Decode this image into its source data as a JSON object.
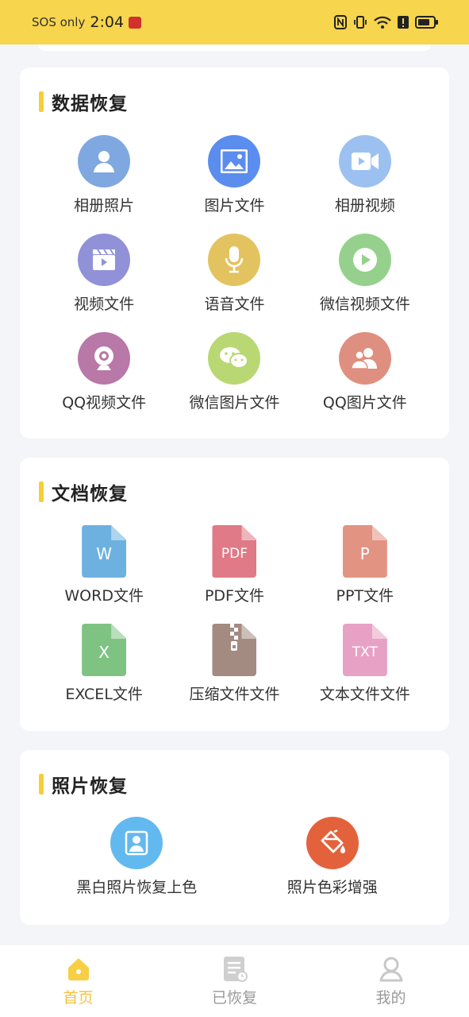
{
  "status": {
    "carrier": "SOS only",
    "time": "2:04"
  },
  "sections": {
    "data_recovery": {
      "title": "数据恢复",
      "items": [
        {
          "label": "相册照片",
          "icon": "user-icon",
          "color": "#7fa8e0"
        },
        {
          "label": "图片文件",
          "icon": "image-icon",
          "color": "#5b8def"
        },
        {
          "label": "相册视频",
          "icon": "video-camera-icon",
          "color": "#9cc1f0"
        },
        {
          "label": "视频文件",
          "icon": "clapper-icon",
          "color": "#9191d8"
        },
        {
          "label": "语音文件",
          "icon": "microphone-icon",
          "color": "#e3c35f"
        },
        {
          "label": "微信视频文件",
          "icon": "play-icon",
          "color": "#95d18c"
        },
        {
          "label": "QQ视频文件",
          "icon": "webcam-icon",
          "color": "#b878a8"
        },
        {
          "label": "微信图片文件",
          "icon": "wechat-icon",
          "color": "#b9d873"
        },
        {
          "label": "QQ图片文件",
          "icon": "group-icon",
          "color": "#df8f80"
        }
      ]
    },
    "doc_recovery": {
      "title": "文档恢复",
      "items": [
        {
          "label": "WORD文件",
          "badge": "W",
          "icon": "word-file-icon",
          "color": "#6db1e0"
        },
        {
          "label": "PDF文件",
          "badge": "PDF",
          "icon": "pdf-file-icon",
          "color": "#e07a86"
        },
        {
          "label": "PPT文件",
          "badge": "P",
          "icon": "ppt-file-icon",
          "color": "#e29382"
        },
        {
          "label": "EXCEL文件",
          "badge": "X",
          "icon": "excel-file-icon",
          "color": "#7fc383"
        },
        {
          "label": "压缩文件文件",
          "badge": "",
          "icon": "zip-file-icon",
          "color": "#a38b82"
        },
        {
          "label": "文本文件文件",
          "badge": "TXT",
          "icon": "txt-file-icon",
          "color": "#e7a1c5"
        }
      ]
    },
    "photo_recovery": {
      "title": "照片恢复",
      "items": [
        {
          "label": "黑白照片恢复上色",
          "icon": "portrait-icon",
          "color": "#62b9ef"
        },
        {
          "label": "照片色彩增强",
          "icon": "paint-bucket-icon",
          "color": "#e3623b"
        }
      ]
    }
  },
  "tabs": [
    {
      "label": "首页",
      "icon": "home-icon",
      "active": true
    },
    {
      "label": "已恢复",
      "icon": "document-clock-icon",
      "active": false
    },
    {
      "label": "我的",
      "icon": "profile-icon",
      "active": false
    }
  ],
  "colors": {
    "accent": "#f7d54d",
    "tab_active": "#f5c23a",
    "tab_inactive": "#999999"
  }
}
